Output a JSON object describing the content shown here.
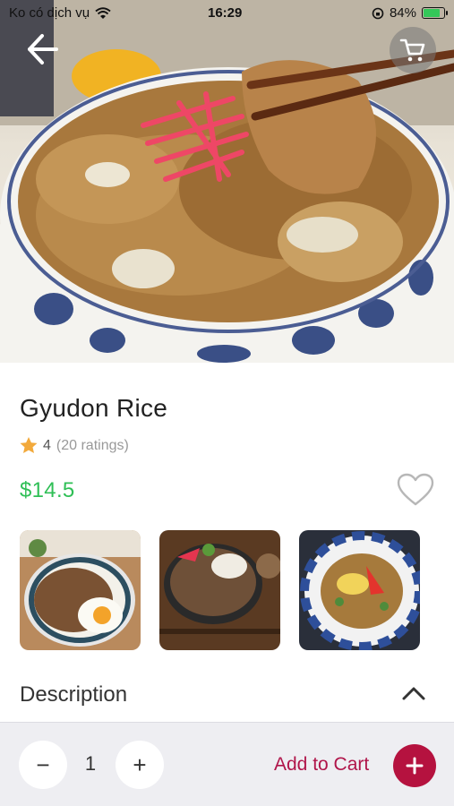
{
  "status_bar": {
    "carrier": "Ko có dịch vụ",
    "time": "16:29",
    "battery": "84%",
    "battery_level": 0.84
  },
  "product": {
    "name": "Gyudon Rice",
    "rating": "4",
    "ratings_count": "(20 ratings)",
    "price": "$14.5",
    "favorited": false
  },
  "gallery": {
    "thumbnails": [
      "gyudon-with-fried-egg",
      "gyudon-with-pickled-ginger",
      "gyudon-in-blue-bowl"
    ]
  },
  "description": {
    "label": "Description",
    "expanded": true
  },
  "cart_bar": {
    "quantity": "1",
    "minus": "−",
    "plus": "+",
    "add_label": "Add to Cart"
  },
  "icons": {
    "back": "back-arrow-icon",
    "cart": "cart-icon",
    "heart": "heart-icon",
    "star": "star-icon",
    "chevron": "chevron-up-icon"
  },
  "colors": {
    "price": "#2fbf56",
    "accent": "#b5123f",
    "star": "#f2a93b",
    "bottom_bar": "#eeeef2"
  }
}
